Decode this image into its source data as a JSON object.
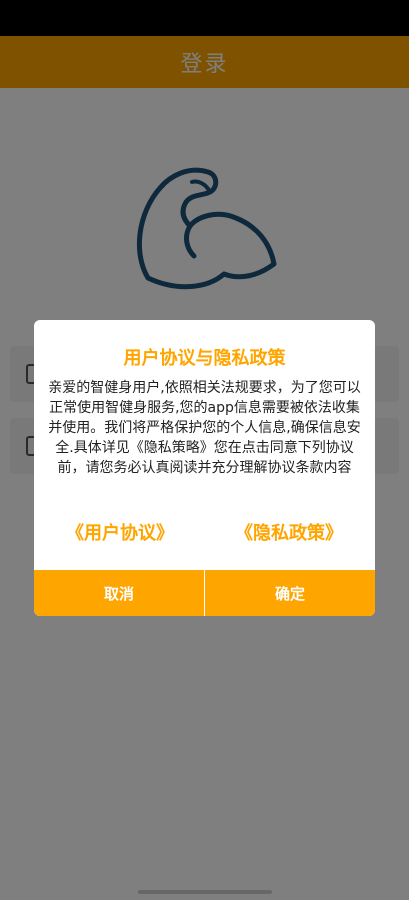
{
  "header": {
    "title": "登录"
  },
  "dialog": {
    "title": "用户协议与隐私政策",
    "body": "亲爱的智健身用户,依照相关法规要求，为了您可以正常使用智健身服务,您的app信息需要被依法收集并使用。我们将严格保护您的个人信息,确保信息安全.具体详见《隐私策略》您在点击同意下列协议前，请您务必认真阅读并充分理解协议条款内容",
    "user_agreement_link": "《用户协议》",
    "privacy_policy_link": "《隐私政策》",
    "cancel_label": "取消",
    "confirm_label": "确定"
  },
  "logo_icon": "flexed-bicep-icon",
  "colors": {
    "accent": "#ffa500",
    "logo_stroke": "#1a5276",
    "overlay": "rgba(0,0,0,0.5)"
  }
}
